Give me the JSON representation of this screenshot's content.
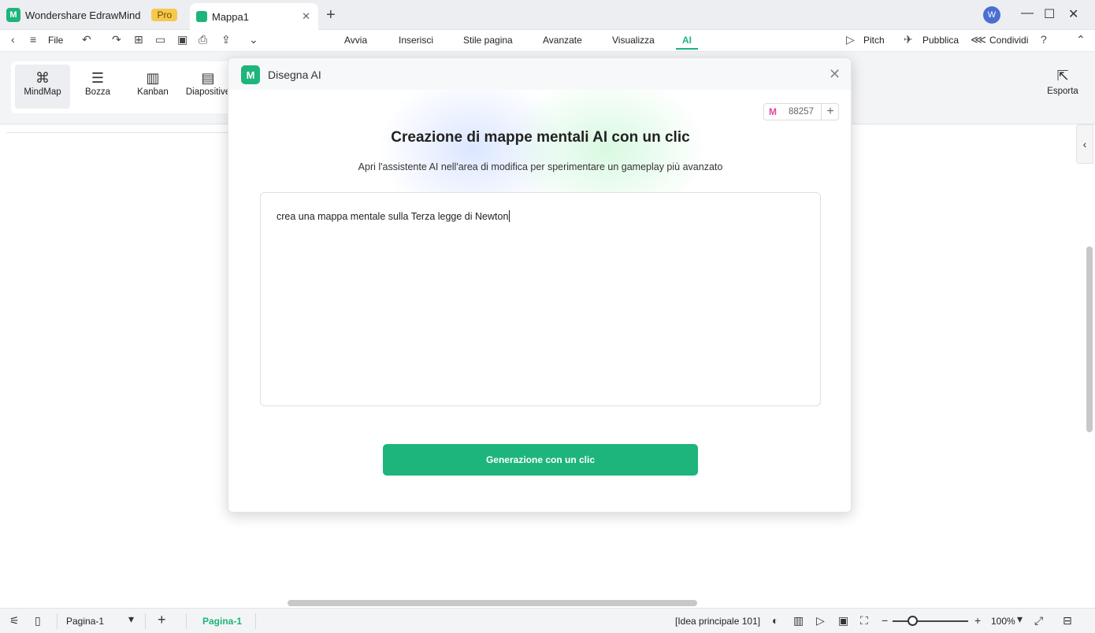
{
  "titlebar": {
    "app_name": "Wondershare EdrawMind",
    "pro_badge": "Pro",
    "doc_tab": "Mappa1",
    "avatar_letter": "W"
  },
  "menubar": {
    "file": "File",
    "tabs": [
      "Avvia",
      "Inserisci",
      "Stile pagina",
      "Avanzate",
      "Visualizza",
      "AI"
    ],
    "active_tab": "AI",
    "pitch": "Pitch",
    "pubblica": "Pubblica",
    "condividi": "Condividi"
  },
  "ribbon": {
    "tools": [
      "MindMap",
      "Bozza",
      "Kanban",
      "Diapositive"
    ],
    "active_tool": "MindMap",
    "export": "Esporta"
  },
  "modal": {
    "title": "Disegna AI",
    "credits": "88257",
    "heading": "Creazione di mappe mentali AI con un clic",
    "subtitle": "Apri l'assistente AI nell'area di modifica per sperimentare un gameplay più avanzato",
    "prompt": "crea una mappa mentale sulla Terza legge di Newton",
    "generate_button": "Generazione con un clic"
  },
  "statusbar": {
    "page_select": "Pagina-1",
    "page_tab": "Pagina-1",
    "idea_count": "[Idea principale 101]",
    "zoom": "100%"
  },
  "colors": {
    "accent": "#1db57b",
    "pro_badge": "#f6c94c"
  }
}
